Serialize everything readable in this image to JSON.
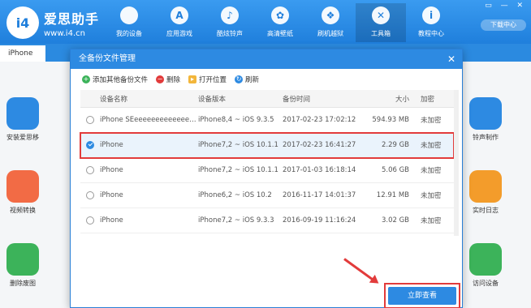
{
  "app": {
    "brand_name": "爱思助手",
    "brand_url": "www.i4.cn",
    "logo_letter": "i4",
    "download_label": "下载中心",
    "window_controls": "▭ — ✕"
  },
  "nav": [
    {
      "label": "我的设备",
      "icon": "apple-icon",
      "glyph": ""
    },
    {
      "label": "应用游戏",
      "icon": "app-store-icon",
      "glyph": "A"
    },
    {
      "label": "酷炫铃声",
      "icon": "bell-icon",
      "glyph": "♪"
    },
    {
      "label": "高清壁纸",
      "icon": "flower-icon",
      "glyph": "✿"
    },
    {
      "label": "刷机越狱",
      "icon": "box-icon",
      "glyph": "❖"
    },
    {
      "label": "工具箱",
      "icon": "tools-icon",
      "glyph": "✕"
    },
    {
      "label": "教程中心",
      "icon": "info-icon",
      "glyph": "i"
    }
  ],
  "sidebar": {
    "tab_label": "iPhone"
  },
  "bg_apps": [
    {
      "label": "安装爱思移",
      "color": "#2d8ae2"
    },
    {
      "label": "视频转换",
      "color": "#f26b45"
    },
    {
      "label": "删除废图",
      "color": "#3cb35a"
    },
    {
      "label": "铃声制作",
      "color": "#2d8ae2"
    },
    {
      "label": "实时日志",
      "color": "#f39c2b"
    },
    {
      "label": "访问设备",
      "color": "#3cb35a"
    }
  ],
  "dialog": {
    "title": "全备份文件管理",
    "close_glyph": "✕",
    "toolbar": [
      {
        "label": "添加其他备份文件",
        "color": "#3cb35a",
        "glyph": "+"
      },
      {
        "label": "删除",
        "color": "#e23b3b",
        "glyph": "−"
      },
      {
        "label": "打开位置",
        "color": "#f3b63b",
        "glyph": "▸"
      },
      {
        "label": "刷新",
        "color": "#2d8ae2",
        "glyph": "↻"
      }
    ],
    "columns": {
      "name": "设备名称",
      "version": "设备版本",
      "time": "备份时间",
      "size": "大小",
      "encrypt": "加密"
    },
    "rows": [
      {
        "name": "iPhone SEeeeeeeeeeeeeeeeeee",
        "version": "iPhone8,4 ~ iOS 9.3.5",
        "time": "2017-02-23 17:02:12",
        "size": "594.93 MB",
        "encrypt": "未加密"
      },
      {
        "name": "iPhone",
        "version": "iPhone7,2 ~ iOS 10.1.1",
        "time": "2017-02-23 16:41:27",
        "size": "2.29 GB",
        "encrypt": "未加密"
      },
      {
        "name": "iPhone",
        "version": "iPhone7,2 ~ iOS 10.1.1",
        "time": "2017-01-03 16:18:14",
        "size": "5.06 GB",
        "encrypt": "未加密"
      },
      {
        "name": "iPhone",
        "version": "iPhone6,2 ~ iOS 10.2",
        "time": "2016-11-17 14:01:37",
        "size": "12.91 MB",
        "encrypt": "未加密"
      },
      {
        "name": "iPhone",
        "version": "iPhone7,2 ~ iOS 9.3.3",
        "time": "2016-09-19 11:16:24",
        "size": "3.02 GB",
        "encrypt": "未加密"
      }
    ],
    "primary_button": "立即查看"
  }
}
